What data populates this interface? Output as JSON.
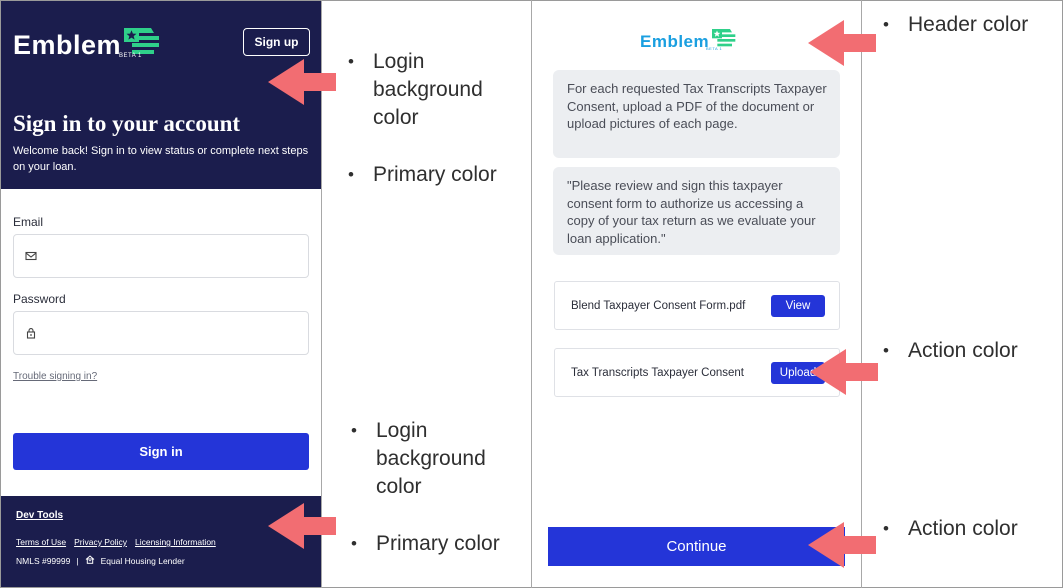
{
  "login": {
    "logo_text": "Emblem",
    "beta_label": "BETA 1",
    "signup_label": "Sign up",
    "title": "Sign in to your account",
    "subtitle": "Welcome back! Sign in to view status or complete next steps on your loan.",
    "email_label": "Email",
    "email_value": "",
    "password_label": "Password",
    "password_value": "",
    "trouble_link": "Trouble signing in?",
    "signin_label": "Sign in",
    "footer": {
      "devtools": "Dev Tools",
      "links": [
        "Terms of Use",
        "Privacy Policy",
        "Licensing Information"
      ],
      "nmls": "NMLS #99999",
      "separator": "|",
      "housing": "Equal Housing Lender"
    }
  },
  "callouts": {
    "login_bg_1": "Login background color",
    "primary_1": "Primary color",
    "login_bg_2": "Login background color",
    "primary_2": "Primary color",
    "header": "Header color",
    "action_1": "Action color",
    "action_2": "Action color",
    "bullet": "•"
  },
  "mobile": {
    "logo_text": "Emblem",
    "beta_label": "BETA 1",
    "bubble_1": "For each requested Tax Transcripts Taxpayer Consent, upload a PDF of the document or upload pictures of each page.",
    "bubble_2": "\"Please review and sign this taxpayer consent form to authorize us accessing a copy of your tax return as we evaluate your loan application.\"",
    "doc_1_name": "Blend Taxpayer Consent Form.pdf",
    "doc_1_action": "View",
    "doc_2_name": "Tax Transcripts Taxpayer Consent",
    "doc_2_action": "Upload",
    "continue_label": "Continue"
  },
  "colors": {
    "login_background": "#1b1d4d",
    "action": "#2435d8",
    "logo_green": "#2fd08a",
    "header_logo": "#1a9fe0",
    "arrow": "#f26d72",
    "bubble_bg": "#eceef1"
  },
  "icons": {
    "email_field": "envelope-icon",
    "password_field": "lock-icon",
    "housing": "house-icon",
    "logo_flag": "flag-star-icon",
    "callout_pointer": "arrow-left-icon"
  }
}
